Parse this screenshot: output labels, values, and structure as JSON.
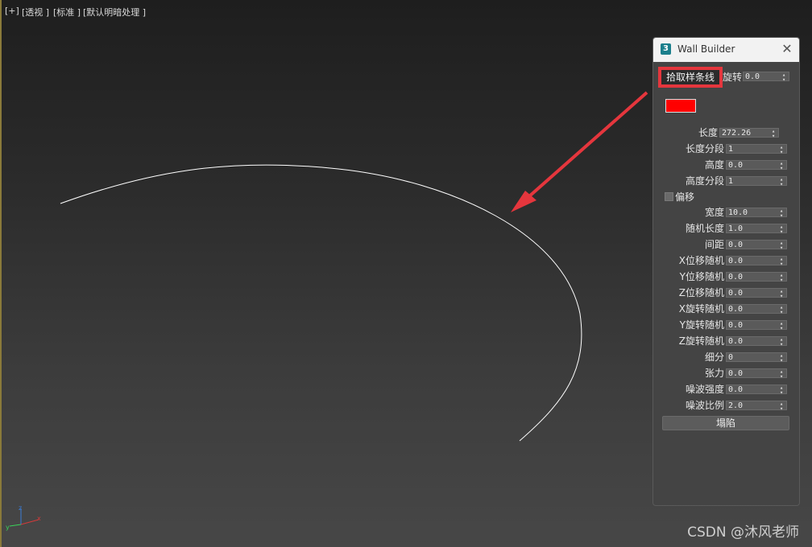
{
  "viewport": {
    "labels": [
      "[+]",
      "[透视 ]",
      "[标准 ]",
      "[默认明暗处理 ]"
    ],
    "watermark": "CSDN @沐风老师"
  },
  "panel": {
    "title": "Wall Builder",
    "app_icon": "3",
    "close_icon": "close-icon",
    "pick_button": "拾取样条线",
    "rotation_label": "旋转",
    "rotation_value": "0.0",
    "color_swatch": "#ff0000",
    "offset_label": "偏移",
    "collapse_button": "塌陷",
    "params": [
      {
        "label": "长度",
        "value": "272.26"
      },
      {
        "label": "长度分段",
        "value": "1"
      },
      {
        "label": "高度",
        "value": "0.0"
      },
      {
        "label": "高度分段",
        "value": "1"
      },
      {
        "label": "宽度",
        "value": "10.0"
      },
      {
        "label": "随机长度",
        "value": "1.0"
      },
      {
        "label": "间距",
        "value": "0.0"
      },
      {
        "label": "X位移随机",
        "value": "0.0"
      },
      {
        "label": "Y位移随机",
        "value": "0.0"
      },
      {
        "label": "Z位移随机",
        "value": "0.0"
      },
      {
        "label": "X旋转随机",
        "value": "0.0"
      },
      {
        "label": "Y旋转随机",
        "value": "0.0"
      },
      {
        "label": "Z旋转随机",
        "value": "0.0"
      },
      {
        "label": "细分",
        "value": "0"
      },
      {
        "label": "张力",
        "value": "0.0"
      },
      {
        "label": "噪波强度",
        "value": "0.0"
      },
      {
        "label": "噪波比例",
        "value": "2.0"
      }
    ]
  },
  "colors": {
    "highlight": "#e5363d",
    "curve": "#ffffff"
  }
}
